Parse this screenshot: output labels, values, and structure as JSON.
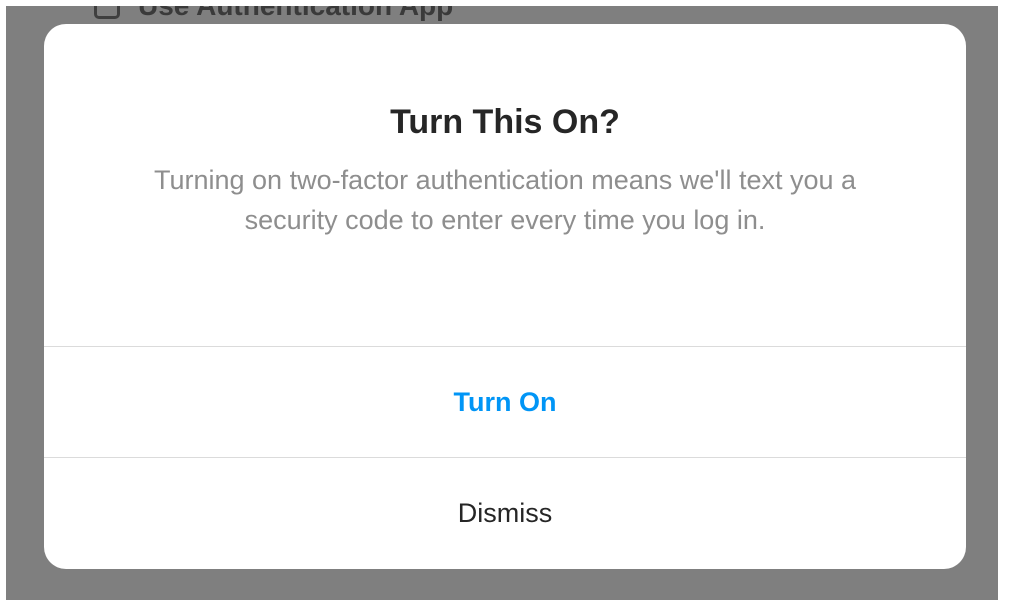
{
  "background": {
    "option_label": "Use Authentication App"
  },
  "dialog": {
    "title": "Turn This On?",
    "message": "Turning on two-factor authentication means we'll text you a security code to enter every time you log in.",
    "primary_button": "Turn On",
    "secondary_button": "Dismiss"
  },
  "colors": {
    "accent": "#0095f6",
    "overlay": "#7f7f7f",
    "title": "#262626",
    "message": "#8e8e8e"
  }
}
